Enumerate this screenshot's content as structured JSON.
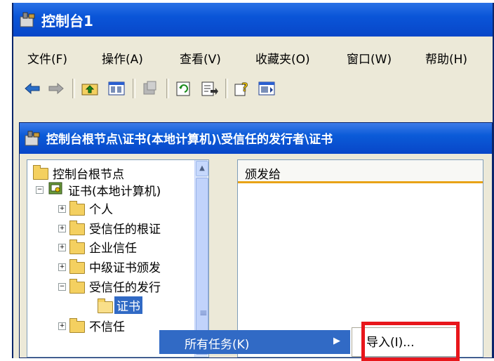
{
  "window": {
    "title": "控制台1",
    "icon": "console-icon"
  },
  "menubar": {
    "items": [
      "文件(F)",
      "操作(A)",
      "查看(V)",
      "收藏夹(O)",
      "窗口(W)",
      "帮助(H)"
    ]
  },
  "toolbar": {
    "icons": [
      "back-arrow-icon",
      "forward-arrow-icon",
      "up-folder-icon",
      "show-hide-tree-icon",
      "delete-icon",
      "refresh-icon",
      "export-list-icon",
      "help-icon",
      "show-hide-action-pane-icon"
    ]
  },
  "child_window": {
    "title": "控制台根节点\\证书(本地计算机)\\受信任的发行者\\证书"
  },
  "tree": {
    "root": "控制台根节点",
    "cert_store": "证书(本地计算机)",
    "items": [
      "个人",
      "受信任的根证",
      "企业信任",
      "中级证书颁发",
      "受信任的发行"
    ],
    "selected": "证书",
    "last": "不信任"
  },
  "list": {
    "column_header": "颁发给"
  },
  "context_menu": {
    "item": "所有任务(K)"
  },
  "submenu": {
    "item": "导入(I)..."
  },
  "colors": {
    "title_bar": "#0a55d8",
    "highlight_box": "#e8161b",
    "menu_selection": "#316ac5"
  }
}
